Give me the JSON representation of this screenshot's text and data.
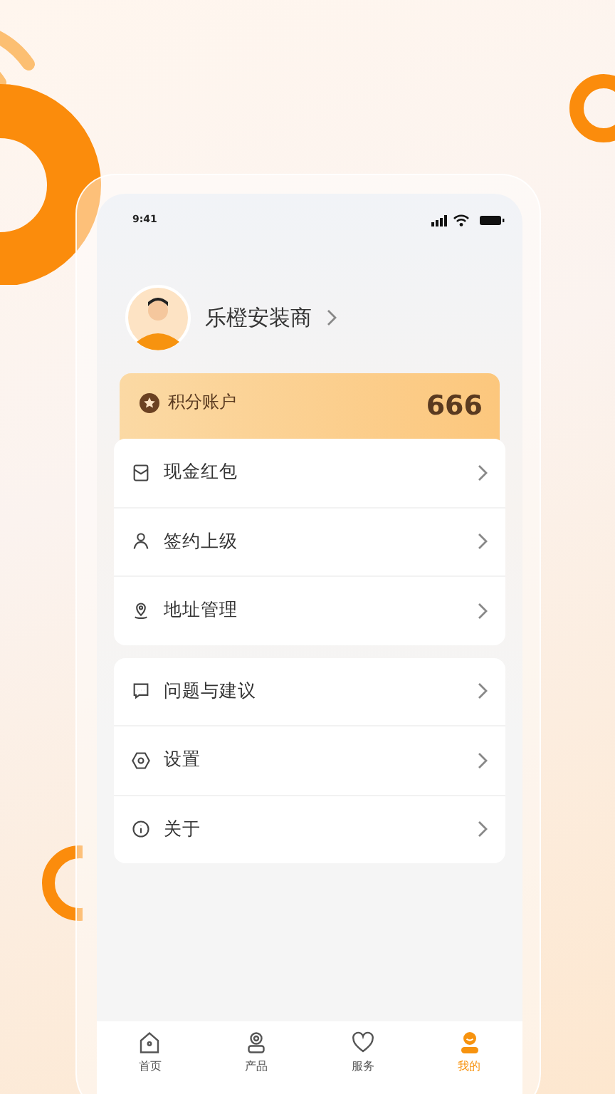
{
  "status_bar": {
    "time": "9:41"
  },
  "profile": {
    "name": "乐橙安装商"
  },
  "points": {
    "label": "积分账户",
    "value": "666"
  },
  "menu_groups": [
    {
      "items": [
        {
          "kind": "envelope",
          "label": "现金红包"
        },
        {
          "kind": "person",
          "label": "签约上级"
        },
        {
          "kind": "location",
          "label": "地址管理"
        }
      ]
    },
    {
      "items": [
        {
          "kind": "chat",
          "label": "问题与建议"
        },
        {
          "kind": "settings",
          "label": "设置"
        },
        {
          "kind": "info",
          "label": "关于"
        }
      ]
    }
  ],
  "tab_bar": [
    {
      "kind": "home",
      "label": "首页",
      "selected": false
    },
    {
      "kind": "camera",
      "label": "产品",
      "selected": false
    },
    {
      "kind": "heart",
      "label": "服务",
      "selected": false
    },
    {
      "kind": "user",
      "label": "我的",
      "selected": true
    }
  ]
}
